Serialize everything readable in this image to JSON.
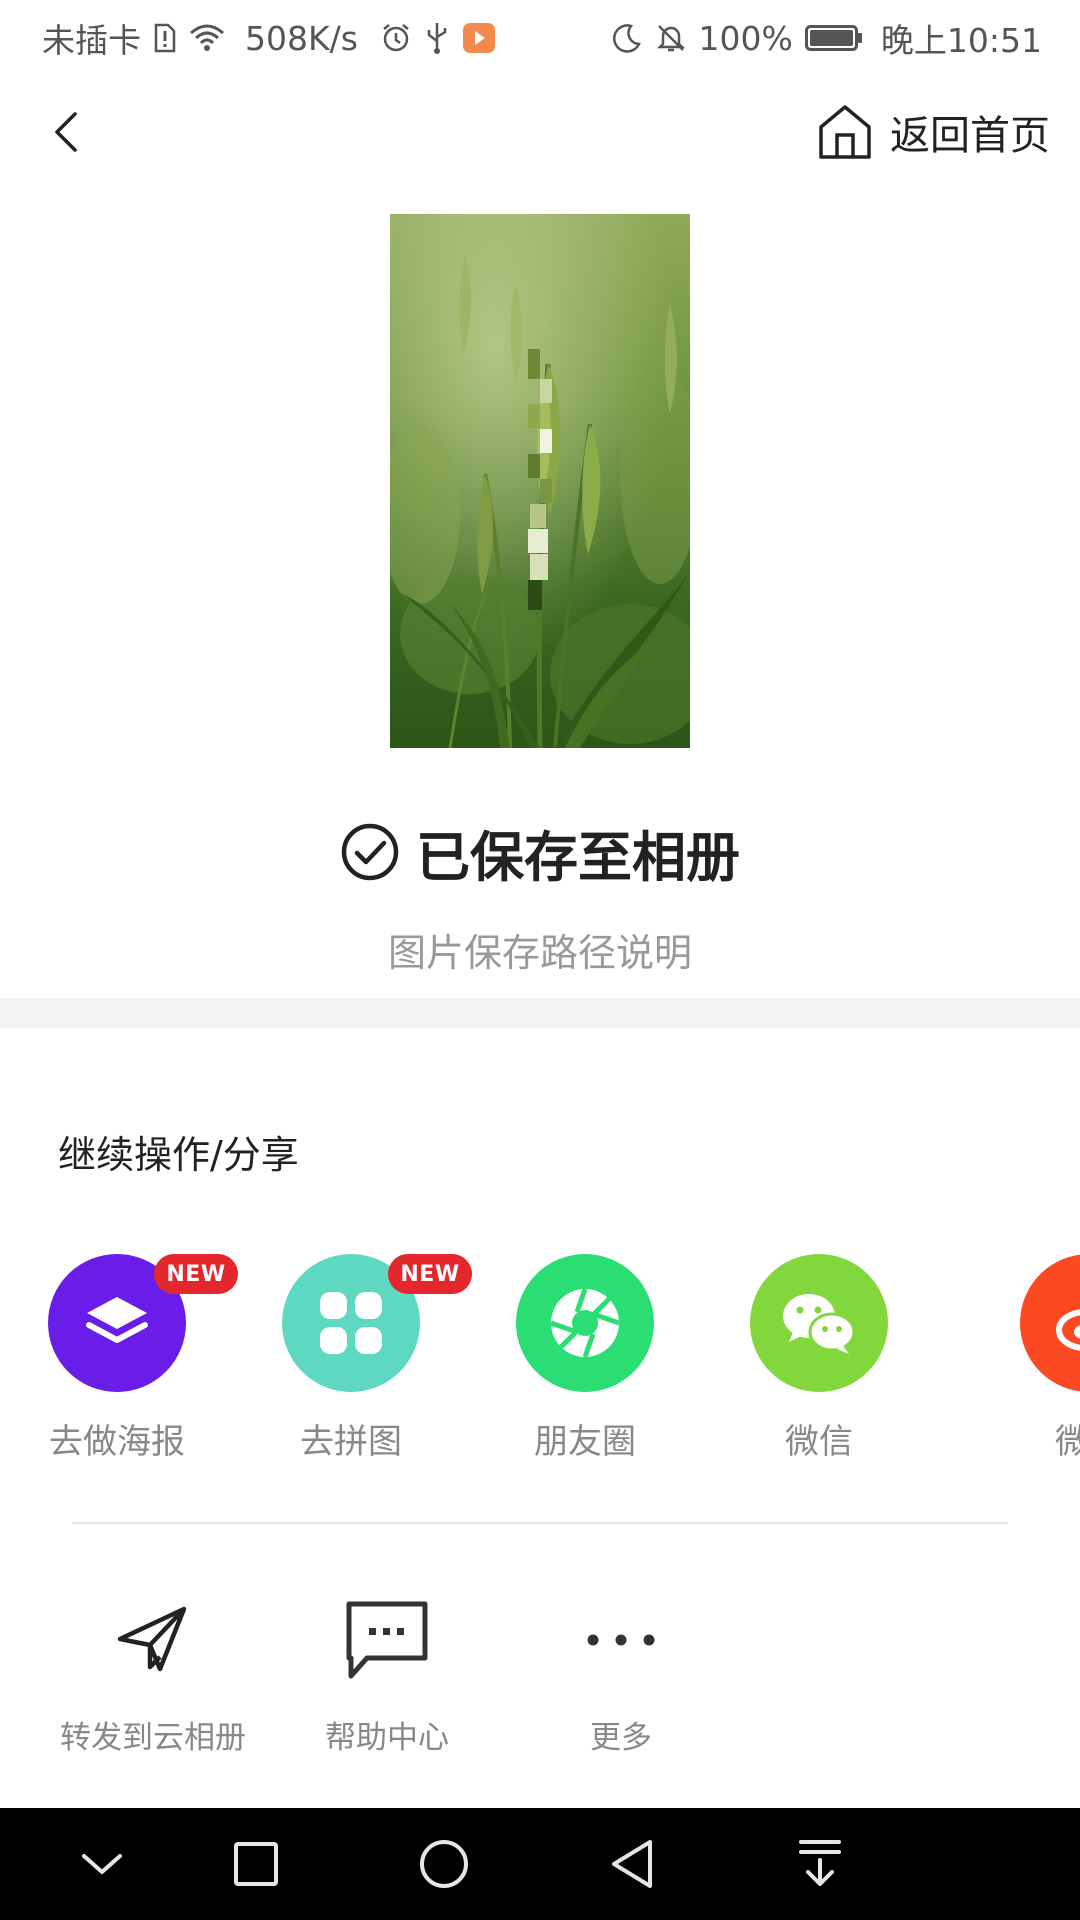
{
  "status_bar": {
    "carrier": "未插卡",
    "speed": "508K/s",
    "battery": "100%",
    "time": "晚上10:51"
  },
  "header": {
    "home_label": "返回首页"
  },
  "saved": {
    "title": "已保存至相册",
    "subtitle": "图片保存路径说明"
  },
  "share": {
    "section_title": "继续操作/分享",
    "items": [
      {
        "label": "去做海报",
        "badge": "NEW",
        "color": "#6a1de8",
        "icon": "layers-icon"
      },
      {
        "label": "去拼图",
        "badge": "NEW",
        "color": "#5ed8c0",
        "icon": "grid-icon"
      },
      {
        "label": "朋友圈",
        "color": "#2bde73",
        "icon": "moments-aperture-icon"
      },
      {
        "label": "微信",
        "color": "#82d73c",
        "icon": "wechat-icon"
      },
      {
        "label": "微博",
        "color": "#fb4a22",
        "icon": "weibo-icon"
      }
    ]
  },
  "tools": [
    {
      "label": "转发到云相册",
      "icon": "send-icon"
    },
    {
      "label": "帮助中心",
      "icon": "chat-bubble-icon"
    },
    {
      "label": "更多",
      "icon": "more-icon"
    }
  ]
}
